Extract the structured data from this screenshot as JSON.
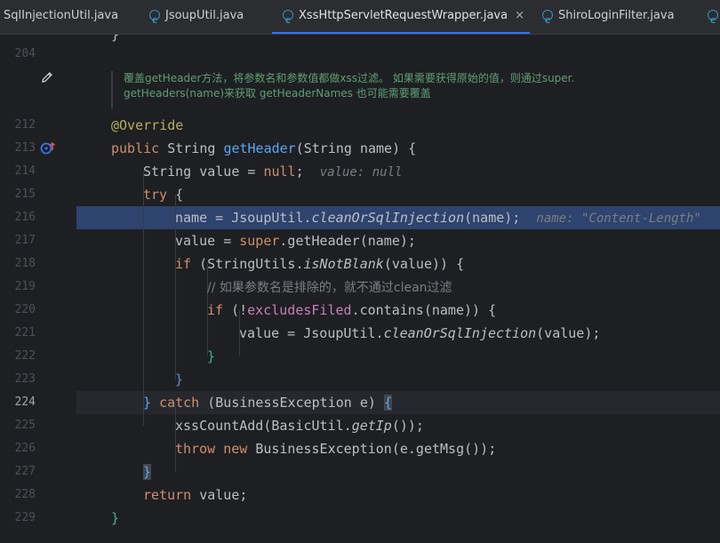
{
  "tabs": [
    {
      "label": "SqlInjectionUtil.java",
      "active": false,
      "has_icon": false
    },
    {
      "label": "JsoupUtil.java",
      "active": false,
      "has_icon": true
    },
    {
      "label": "XssHttpServletRequestWrapper.java",
      "active": true,
      "has_icon": true,
      "close": "×"
    },
    {
      "label": "ShiroLoginFilter.java",
      "active": false,
      "has_icon": true
    }
  ],
  "gutter": {
    "lines": [
      "204",
      "212",
      "213",
      "214",
      "215",
      "216",
      "217",
      "218",
      "219",
      "220",
      "221",
      "222",
      "223",
      "224",
      "225",
      "226",
      "227",
      "228",
      "229"
    ],
    "edit_icon": "pencil-icon",
    "override_icon": "override-up-icon"
  },
  "doc_comment": {
    "line1": "覆盖getHeader方法，将参数名和参数值都做xss过滤。 如果需要获得原始的值，则通过super.",
    "line2": "getHeaders(name)来获取 getHeaderNames 也可能需要覆盖"
  },
  "code": {
    "top_brace": "}",
    "annotation": "@Override",
    "l213": {
      "kw": "public",
      "type": "String",
      "fn": "getHeader",
      "open": "(",
      "ptype": "String",
      "pname": "name",
      "close": ")",
      "brace": "{"
    },
    "l214": {
      "type": "String",
      "var": "value",
      "eq": "=",
      "kw": "null",
      "semi": ";",
      "hint": "value: null"
    },
    "l215": {
      "kw": "try",
      "brace": "{"
    },
    "l216": {
      "lhs": "name",
      "eq": "=",
      "cls": "JsoupUtil",
      "dot": ".",
      "method": "cleanOrSqlInjection",
      "args": "(name);",
      "hint": "name: \"Content-Length\""
    },
    "l217": {
      "lhs": "value",
      "eq": "=",
      "kw": "super",
      "rest": ".getHeader(name);"
    },
    "l218": {
      "kw": "if",
      "pre": "(StringUtils.",
      "method": "isNotBlank",
      "post": "(value)) {"
    },
    "l219": {
      "comment": "// 如果参数名是排除的，就不通过clean过滤"
    },
    "l220": {
      "kw": "if",
      "pre": "(!",
      "field": "excludesFiled",
      "post": ".contains(name)) {"
    },
    "l221": {
      "pre": "value = JsoupUtil.",
      "method": "cleanOrSqlInjection",
      "post": "(value);"
    },
    "l222": {
      "brace": "}"
    },
    "l223": {
      "brace": "}"
    },
    "l224": {
      "close": "}",
      "kw": "catch",
      "rest": "(BusinessException e)",
      "brace": "{"
    },
    "l225": {
      "pre": "xssCountAdd(BasicUtil.",
      "method": "getIp",
      "post": "());"
    },
    "l226": {
      "kw1": "throw",
      "kw2": "new",
      "rest": "BusinessException(e.getMsg());"
    },
    "l227": {
      "brace": "}"
    },
    "l228": {
      "kw": "return",
      "rest": "value;"
    },
    "l229": {
      "brace": "}"
    }
  },
  "colors": {
    "background": "#1e1f22",
    "keyword": "#cf8e6d",
    "function": "#56a8f5",
    "annotation": "#b3ae60",
    "field": "#c77dbb",
    "doc": "#5f9f74",
    "tab_active_underline": "#3574f0"
  }
}
